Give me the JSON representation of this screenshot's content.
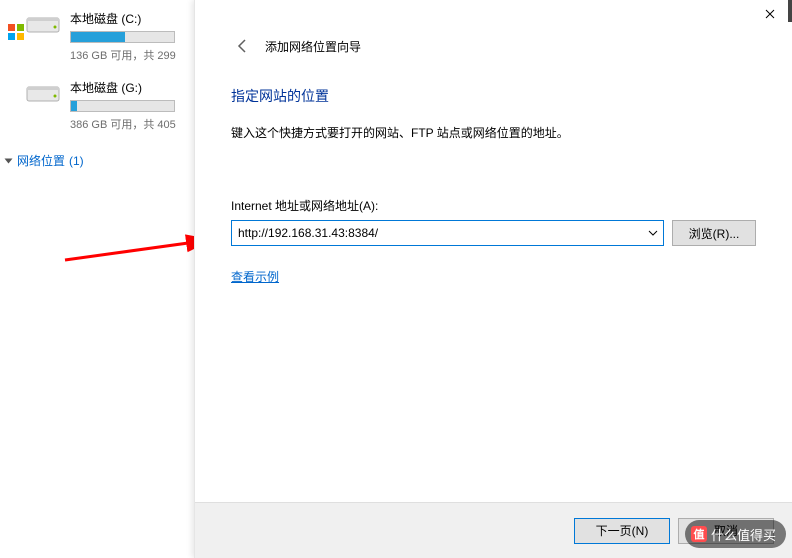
{
  "explorer": {
    "drives": [
      {
        "name": "本地磁盘 (C:)",
        "stats": "136 GB 可用，共 299",
        "fill": 52
      },
      {
        "name": "本地磁盘 (G:)",
        "stats": "386 GB 可用，共 405",
        "fill": 6
      }
    ],
    "section": {
      "label": "网络位置",
      "count": "(1)"
    }
  },
  "wizard": {
    "title": "添加网络位置向导",
    "heading": "指定网站的位置",
    "description": "键入这个快捷方式要打开的网站、FTP 站点或网络位置的地址。",
    "field_label": "Internet 地址或网络地址(A):",
    "url_value": "http://192.168.31.43:8384/",
    "browse_label": "浏览(R)...",
    "example_link": "查看示例",
    "next_label": "下一页(N)",
    "cancel_label": "取消"
  },
  "watermark": {
    "text": "什么值得买"
  }
}
